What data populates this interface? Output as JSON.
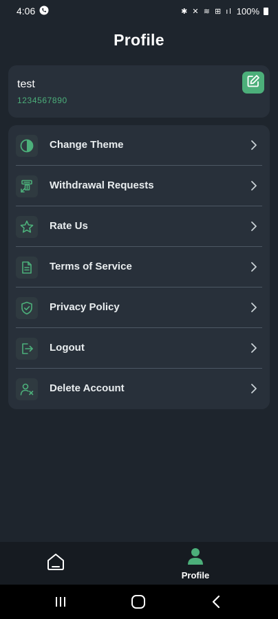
{
  "status_bar": {
    "time": "4:06",
    "icons": "✱ ✕ ≋ ⊞ ıl",
    "battery": "100%"
  },
  "header": {
    "title": "Profile"
  },
  "user": {
    "name": "test",
    "phone": "1234567890",
    "edit_icon": "edit-icon"
  },
  "menu": {
    "items": [
      {
        "label": "Change Theme",
        "icon": "theme-contrast-icon"
      },
      {
        "label": "Withdrawal Requests",
        "icon": "money-transfer-icon"
      },
      {
        "label": "Rate Us",
        "icon": "star-icon"
      },
      {
        "label": "Terms of Service",
        "icon": "document-icon"
      },
      {
        "label": "Privacy Policy",
        "icon": "shield-check-icon"
      },
      {
        "label": "Logout",
        "icon": "logout-icon"
      },
      {
        "label": "Delete Account",
        "icon": "delete-user-icon"
      }
    ]
  },
  "bottom_nav": {
    "home_icon": "home-icon",
    "profile_label": "Profile"
  },
  "colors": {
    "background": "#1e252d",
    "card": "#28303a",
    "accent": "#4caf7a",
    "nav_background": "#161b21"
  }
}
